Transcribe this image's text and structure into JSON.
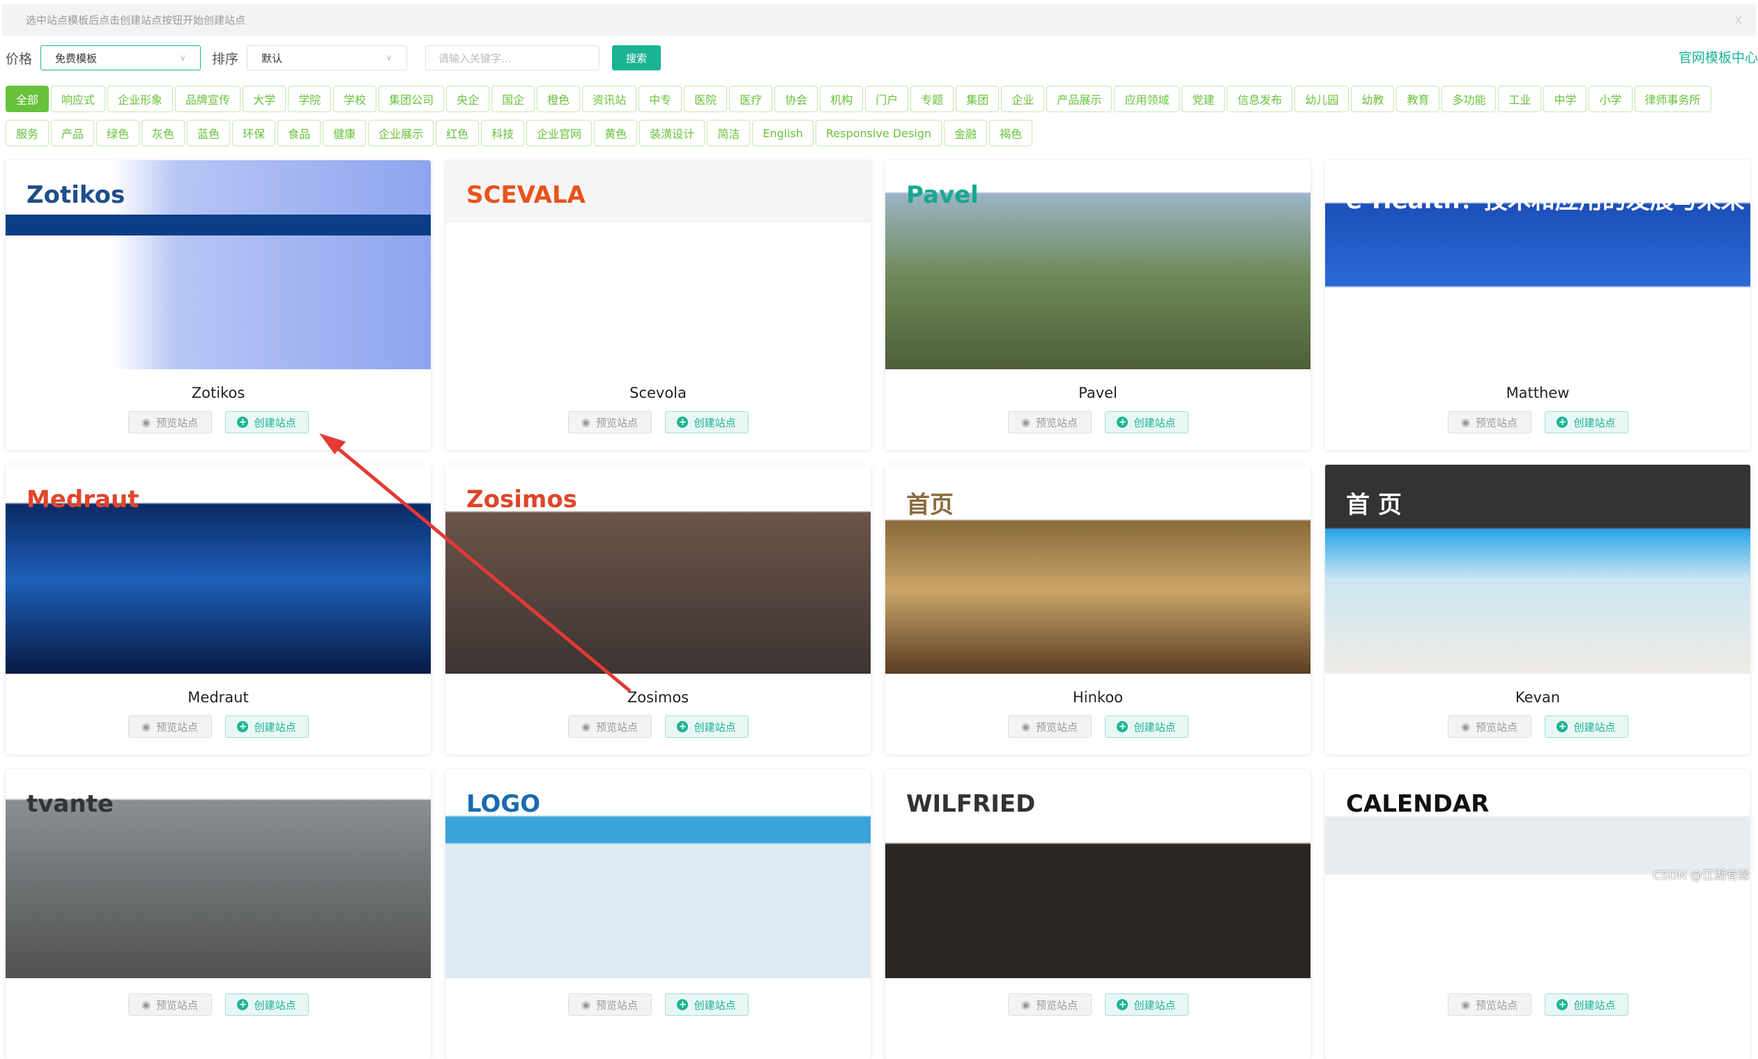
{
  "banner": {
    "text": "选中站点模板后点击创建站点按钮开始创建站点",
    "close": "X"
  },
  "filters": {
    "price_label": "价格",
    "price_value": "免费模板",
    "sort_label": "排序",
    "sort_value": "默认",
    "search_placeholder": "请输入关键字...",
    "search_button": "搜索",
    "official_link": "官网模板中心"
  },
  "tags": [
    "全部",
    "响应式",
    "企业形象",
    "品牌宣传",
    "大学",
    "学院",
    "学校",
    "集团公司",
    "央企",
    "国企",
    "橙色",
    "资讯站",
    "中专",
    "医院",
    "医疗",
    "协会",
    "机构",
    "门户",
    "专题",
    "集团",
    "企业",
    "产品展示",
    "应用领域",
    "党建",
    "信息发布",
    "幼儿园",
    "幼教",
    "教育",
    "多功能",
    "工业",
    "中学",
    "小学",
    "律师事务所",
    "服务",
    "产品",
    "绿色",
    "灰色",
    "蓝色",
    "环保",
    "食品",
    "健康",
    "企业展示",
    "红色",
    "科技",
    "企业官网",
    "黄色",
    "装潢设计",
    "简洁",
    "English",
    "Responsive Design",
    "金融",
    "褐色"
  ],
  "active_tag": "全部",
  "card_buttons": {
    "preview": "预览站点",
    "create": "创建站点"
  },
  "cards": [
    {
      "name": "Zotikos",
      "logo": "Zotikos",
      "bg": "linear-gradient(90deg,#fff 0,#fff 25%,#b8c6f5 40%,#8ea4ee 100%)",
      "nav": "#0d3d86",
      "color": "#1f4e8a"
    },
    {
      "name": "Scevola",
      "logo": "SCEVALA",
      "bg": "linear-gradient(180deg,#f5f5f5 0,#f5f5f5 30%,#fff 30%)",
      "nav": "",
      "color": "#e8531c"
    },
    {
      "name": "Pavel",
      "logo": "Pavel",
      "bg": "linear-gradient(180deg,#fff 0,#fff 15%,#9bb4c6 16%,#6f8a5a 55%,#4d5f3a 100%)",
      "nav": "",
      "color": "#17a88f"
    },
    {
      "name": "Matthew",
      "logo": "e-Health：技术和应用的发展与未来",
      "bg": "linear-gradient(180deg,#fff 0,#fff 20%,#1d4fb8 21%,#2a6ad6 60%,#fff 61%)",
      "nav": "",
      "color": "#fff"
    },
    {
      "name": "Medraut",
      "logo": "Medraut",
      "bg": "linear-gradient(180deg,#fff 0,#fff 18%,#0b2a66 19%,#1e5fb8 55%,#071a45 100%)",
      "nav": "",
      "color": "#e0452b"
    },
    {
      "name": "Zosimos",
      "logo": "Zosimos",
      "bg": "linear-gradient(180deg,#fff 0,#fff 22%,#6a5548 23%,#3d3432 100%)",
      "nav": "",
      "color": "#e0452b"
    },
    {
      "name": "Hinkoo",
      "logo": "首页",
      "bg": "linear-gradient(180deg,#fff 0,#fff 26%,#8a6a3c 27%,#caa56a 60%,#5a3d22 100%)",
      "nav": "",
      "color": "#8a6a3c"
    },
    {
      "name": "Kevan",
      "logo": "首 页",
      "bg": "linear-gradient(180deg,#333 0,#333 30%,#2aa6e6 31%,#cbe6f2 55%,#f0ece6 100%)",
      "nav": "",
      "color": "#fff"
    },
    {
      "name": "",
      "logo": "tvante",
      "bg": "linear-gradient(180deg,#fff 0,#fff 14%,#8a8f94 15%,#50524f 100%)",
      "nav": "",
      "color": "#333"
    },
    {
      "name": "",
      "logo": "LOGO",
      "bg": "linear-gradient(180deg,#fff 0,#fff 22%,#3aa3d9 23%,#3aa3d9 35%,#dfeaf2 36%)",
      "nav": "",
      "color": "#1a6ab0"
    },
    {
      "name": "",
      "logo": "WILFRIED",
      "bg": "linear-gradient(180deg,#fff 0,#fff 35%,#2b2622 36%)",
      "nav": "",
      "color": "#333"
    },
    {
      "name": "",
      "logo": "CALENDAR",
      "bg": "linear-gradient(180deg,#fff 0,#fff 22%,#e9edf1 23%,#e9edf1 50%,#fff 51%)",
      "nav": "",
      "color": "#111"
    }
  ],
  "watermark": "CSDN @江湖有缘",
  "colors": {
    "accent": "#1ab394",
    "tag": "#67c23a",
    "arrow": "#e53935"
  }
}
